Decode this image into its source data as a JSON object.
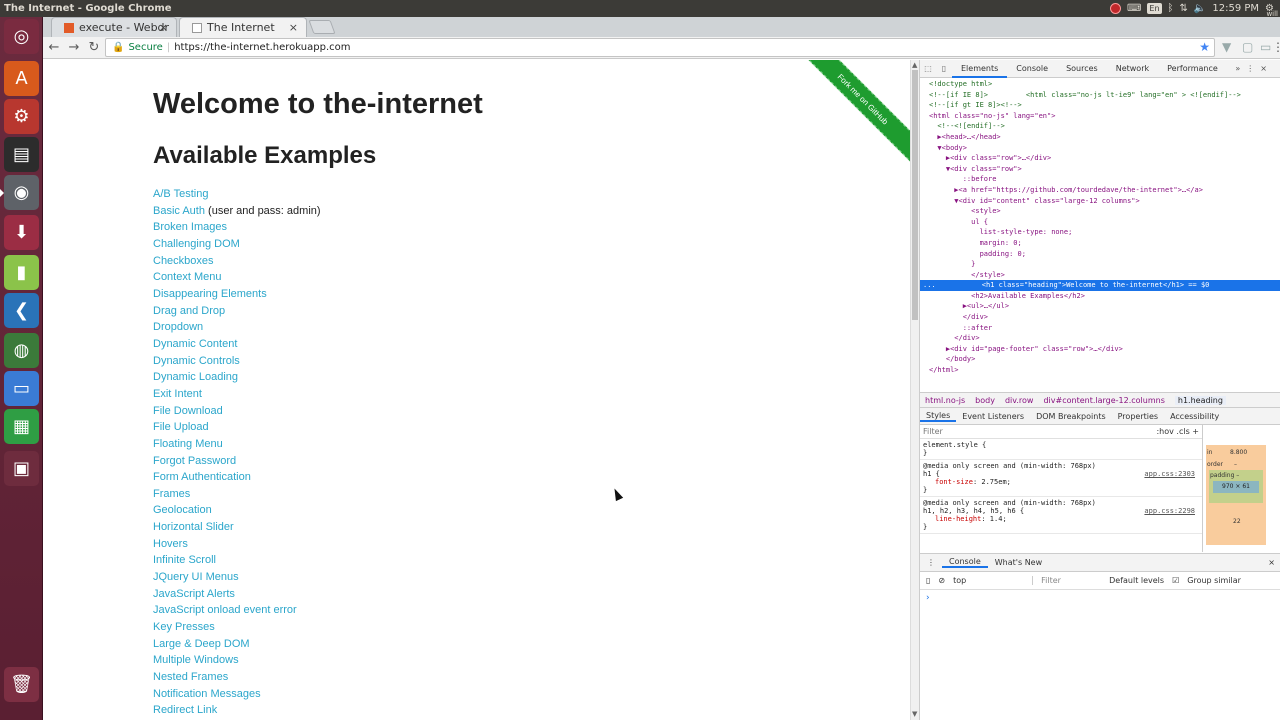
{
  "os": {
    "window_title": "The Internet - Google Chrome",
    "tray": {
      "lang": "En",
      "time": "12:59 PM",
      "user": "will"
    }
  },
  "launcher": {
    "items": [
      {
        "name": "ubuntu-dash-icon",
        "bg": "#7a2b40"
      },
      {
        "name": "software-center-icon",
        "bg": "#d85a1c"
      },
      {
        "name": "system-settings-icon",
        "bg": "#b8372f"
      },
      {
        "name": "terminal-icon",
        "bg": "#2c2c2c"
      },
      {
        "name": "chrome-icon",
        "bg": "#5e6268"
      },
      {
        "name": "installer-icon",
        "bg": "#9b2d44"
      },
      {
        "name": "libreoffice-icon",
        "bg": "#8bc34a"
      },
      {
        "name": "vscode-icon",
        "bg": "#2a73b8"
      },
      {
        "name": "globe-icon",
        "bg": "#3b7a3a"
      },
      {
        "name": "impress-icon",
        "bg": "#3a7bd5"
      },
      {
        "name": "calc-icon",
        "bg": "#2f9e44"
      },
      {
        "name": "workspace-switcher-icon",
        "bg": "#6e2c3e"
      },
      {
        "name": "trash-icon",
        "bg": "#7d2f43"
      }
    ]
  },
  "browser": {
    "tabs": [
      {
        "title": "execute - Webdrive",
        "favicon_color": "#e25b28"
      },
      {
        "title": "The Internet",
        "favicon_color": "#999999"
      }
    ],
    "omnibox": {
      "secure_label": "Secure",
      "url": "https://the-internet.herokuapp.com"
    }
  },
  "page": {
    "heading": "Welcome to the-internet",
    "subheading": "Available Examples",
    "ribbon": "Fork me on GitHub",
    "link_color": "#2ba6cb",
    "examples": [
      {
        "label": "A/B Testing",
        "note": ""
      },
      {
        "label": "Basic Auth",
        "note": " (user and pass: admin)"
      },
      {
        "label": "Broken Images",
        "note": ""
      },
      {
        "label": "Challenging DOM",
        "note": ""
      },
      {
        "label": "Checkboxes",
        "note": ""
      },
      {
        "label": "Context Menu",
        "note": ""
      },
      {
        "label": "Disappearing Elements",
        "note": ""
      },
      {
        "label": "Drag and Drop",
        "note": ""
      },
      {
        "label": "Dropdown",
        "note": ""
      },
      {
        "label": "Dynamic Content",
        "note": ""
      },
      {
        "label": "Dynamic Controls",
        "note": ""
      },
      {
        "label": "Dynamic Loading",
        "note": ""
      },
      {
        "label": "Exit Intent",
        "note": ""
      },
      {
        "label": "File Download",
        "note": ""
      },
      {
        "label": "File Upload",
        "note": ""
      },
      {
        "label": "Floating Menu",
        "note": ""
      },
      {
        "label": "Forgot Password",
        "note": ""
      },
      {
        "label": "Form Authentication",
        "note": ""
      },
      {
        "label": "Frames",
        "note": ""
      },
      {
        "label": "Geolocation",
        "note": ""
      },
      {
        "label": "Horizontal Slider",
        "note": ""
      },
      {
        "label": "Hovers",
        "note": ""
      },
      {
        "label": "Infinite Scroll",
        "note": ""
      },
      {
        "label": "JQuery UI Menus",
        "note": ""
      },
      {
        "label": "JavaScript Alerts",
        "note": ""
      },
      {
        "label": "JavaScript onload event error",
        "note": ""
      },
      {
        "label": "Key Presses",
        "note": ""
      },
      {
        "label": "Large & Deep DOM",
        "note": ""
      },
      {
        "label": "Multiple Windows",
        "note": ""
      },
      {
        "label": "Nested Frames",
        "note": ""
      },
      {
        "label": "Notification Messages",
        "note": ""
      },
      {
        "label": "Redirect Link",
        "note": ""
      }
    ]
  },
  "devtools": {
    "tabs": [
      "Elements",
      "Console",
      "Sources",
      "Network",
      "Performance"
    ],
    "dom_lines": [
      "<!doctype html>",
      "<!--[if IE 8]>         <html class=\"no-js lt-ie9\" lang=\"en\" > <![endif]-->",
      "<!--[if gt IE 8]><!-->",
      "<html class=\"no-js\" lang=\"en\">",
      "  <!--<![endif]-->",
      "  ▶<head>…</head>",
      "  ▼<body>",
      "    ▶<div class=\"row\">…</div>",
      "    ▼<div class=\"row\">",
      "        ::before",
      "      ▶<a href=\"https://github.com/tourdedave/the-internet\">…</a>",
      "      ▼<div id=\"content\" class=\"large-12 columns\">",
      "          <style>",
      "          ul {",
      "            list-style-type: none;",
      "            margin: 0;",
      "            padding: 0;",
      "          }",
      "          </style>",
      "          <h1 class=\"heading\">Welcome to the-internet</h1> == $0",
      "          <h2>Available Examples</h2>",
      "        ▶<ul>…</ul>",
      "        </div>",
      "        ::after",
      "      </div>",
      "    ▶<div id=\"page-footer\" class=\"row\">…</div>",
      "    </body>",
      "</html>"
    ],
    "selected_line": 19,
    "selected_prefix": "...",
    "breadcrumbs": [
      "html.no-js",
      "body",
      "div.row",
      "div#content.large-12.columns",
      "h1.heading"
    ],
    "styles_tabs": [
      "Styles",
      "Event Listeners",
      "DOM Breakpoints",
      "Properties",
      "Accessibility"
    ],
    "filter_placeholder": "Filter",
    "filter_tools": ":hov  .cls  +",
    "style_blocks": [
      {
        "selector": "element.style {",
        "props": [],
        "close": "}",
        "source": ""
      },
      {
        "selector": "@media only screen and (min-width: 768px)\nh1 {",
        "props": [
          {
            "n": "font-size",
            "v": "2.75em;"
          }
        ],
        "close": "}",
        "source": "app.css:2303"
      },
      {
        "selector": "@media only screen and (min-width: 768px)\nh1, h2, h3, h4, h5, h6 {",
        "props": [
          {
            "n": "line-height",
            "v": "1.4;"
          }
        ],
        "close": "}",
        "source": "app.css:2298"
      }
    ],
    "box_model": {
      "margin_label": "in",
      "margin_value": "8.800",
      "border_label": "order",
      "border_value": "–",
      "padding_label": "padding –",
      "content": "970 × 61",
      "bottom_value": "22"
    },
    "drawer": {
      "tabs": [
        "Console",
        "What's New"
      ],
      "context": "top",
      "filter": "Filter",
      "levels": "Default levels",
      "group_similar": "Group similar",
      "prompt": "›"
    }
  }
}
